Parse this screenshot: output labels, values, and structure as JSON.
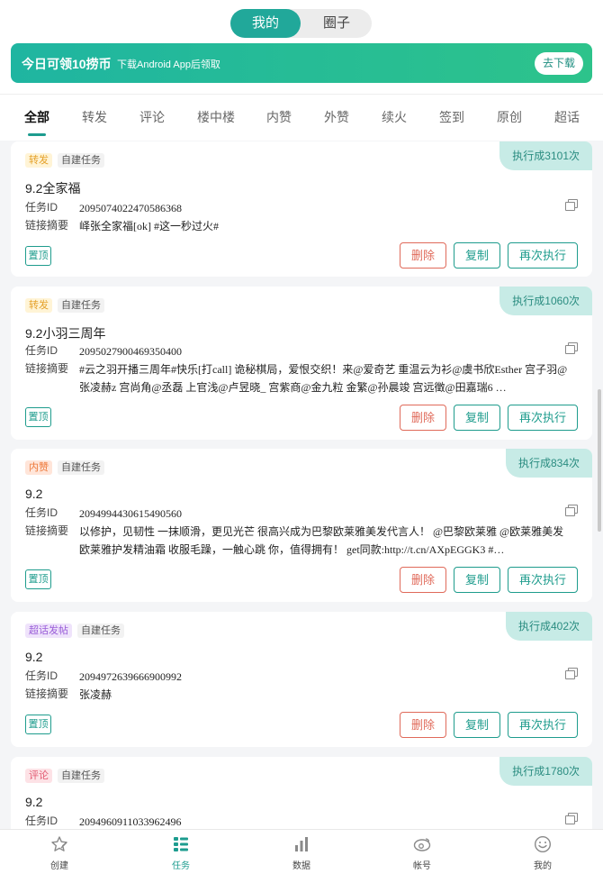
{
  "segment": {
    "mine": "我的",
    "circle": "圈子"
  },
  "banner": {
    "title": "今日可领10捞币",
    "subtitle": "下载Android App后领取",
    "button": "去下载"
  },
  "tabs": [
    "全部",
    "转发",
    "评论",
    "楼中楼",
    "内赞",
    "外赞",
    "续火",
    "签到",
    "原创",
    "超话"
  ],
  "labels": {
    "task_id": "任务ID",
    "summary": "链接摘要",
    "pin": "置顶",
    "delete": "删除",
    "copy": "复制",
    "rerun": "再次执行"
  },
  "cards": [
    {
      "type": "转发",
      "source": "自建任务",
      "badge": "执行成3101次",
      "title": "9.2全家福",
      "task_id": "2095074022470586368",
      "summary": "峄张全家福[ok] #这一秒过火#"
    },
    {
      "type": "转发",
      "source": "自建任务",
      "badge": "执行成1060次",
      "title": "9.2小羽三周年",
      "task_id": "2095027900469350400",
      "summary": "#云之羽开播三周年#快乐[打call] 诡秘棋局，爱恨交织！来@爱奇艺 重温云为衫@虞书欣Esther 宫子羽@张凌赫z 宫尚角@丞磊 上官浅@卢昱晓_ 宫紫商@金九粒 金繁@孙晨竣 宫远徵@田嘉瑞6 …"
    },
    {
      "type": "内赞",
      "source": "自建任务",
      "badge": "执行成834次",
      "title": "9.2",
      "task_id": "2094994430615490560",
      "summary": "以修护，见韧性 一抹顺滑，更见光芒 很高兴成为巴黎欧莱雅美发代言人！ @巴黎欧莱雅 @欧莱雅美发 欧莱雅护发精油霜 收服毛躁，一触心跳 你，值得拥有！ get同款:http://t.cn/AXpEGGK3 #…"
    },
    {
      "type": "超话发帖",
      "source": "自建任务",
      "badge": "执行成402次",
      "title": "9.2",
      "task_id": "2094972639666900992",
      "summary": "张凌赫"
    },
    {
      "type": "评论",
      "source": "自建任务",
      "badge": "执行成1780次",
      "title": "9.2",
      "task_id": "2094960911033962496",
      "summary": ""
    }
  ],
  "bottom_nav": [
    {
      "label": "创建",
      "icon": "create-icon"
    },
    {
      "label": "任务",
      "icon": "tasks-icon"
    },
    {
      "label": "数据",
      "icon": "bar-chart-icon"
    },
    {
      "label": "帐号",
      "icon": "account-icon"
    },
    {
      "label": "我的",
      "icon": "smile-icon"
    }
  ],
  "colors": {
    "accent": "#1d9c8f",
    "danger": "#e06a5a",
    "badge_bg": "#c7ebe6"
  }
}
